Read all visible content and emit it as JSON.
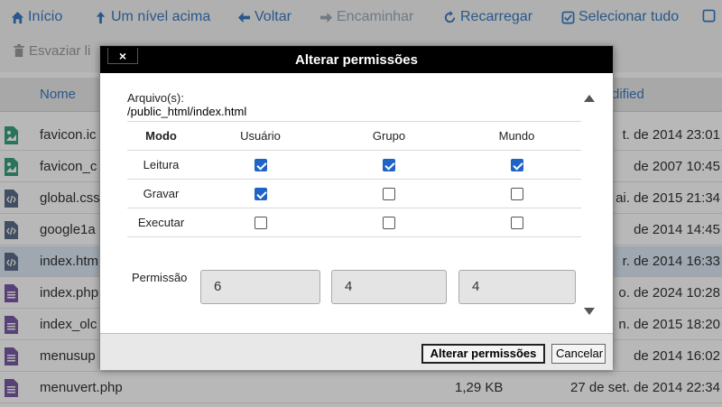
{
  "toolbar": {
    "home": "Início",
    "up": "Um nível acima",
    "back": "Voltar",
    "forward": "Encaminhar",
    "reload": "Recarregar",
    "select_all": "Selecionar tudo",
    "empty_trash": "Esvaziar li"
  },
  "list": {
    "col_name": "Nome",
    "col_modified": "dified",
    "rows": [
      {
        "name": "favicon.ic",
        "size": "",
        "date": "t. de 2014 23:01",
        "type": "image"
      },
      {
        "name": "favicon_c",
        "size": "",
        "date": "de 2007 10:45",
        "type": "image"
      },
      {
        "name": "global.css",
        "size": "",
        "date": "ai. de 2015 21:34",
        "type": "code"
      },
      {
        "name": "google1a",
        "size": "",
        "date": "de 2014 14:45",
        "type": "code"
      },
      {
        "name": "index.htm",
        "size": "",
        "date": "r. de 2014 16:33",
        "type": "code"
      },
      {
        "name": "index.php",
        "size": "",
        "date": "o. de 2024 10:28",
        "type": "php"
      },
      {
        "name": "index_olc",
        "size": "",
        "date": "n. de 2015 18:20",
        "type": "php"
      },
      {
        "name": "menusup",
        "size": "",
        "date": "de 2014 16:02",
        "type": "php"
      },
      {
        "name": "menuvert.php",
        "size": "1,29 KB",
        "date": "27 de set. de 2014 22:34",
        "type": "php"
      }
    ]
  },
  "dialog": {
    "close": "×",
    "title": "Alterar permissões",
    "file_label": "Arquivo(s):",
    "file_path": "/public_html/index.html",
    "headers": {
      "mode": "Modo",
      "user": "Usuário",
      "group": "Grupo",
      "world": "Mundo"
    },
    "rows": [
      {
        "label": "Leitura",
        "user": true,
        "group": true,
        "world": true
      },
      {
        "label": "Gravar",
        "user": true,
        "group": false,
        "world": false
      },
      {
        "label": "Executar",
        "user": false,
        "group": false,
        "world": false
      }
    ],
    "permission_label": "Permissão",
    "permission_values": {
      "user": "6",
      "group": "4",
      "world": "4"
    },
    "apply_button": "Alterar permissões",
    "cancel_button": "Cancelar"
  },
  "colors": {
    "link": "#3a7bbf",
    "checkbox_checked": "#1f63c6",
    "titlebar": "#000000",
    "icon_image": "#3aa17e",
    "icon_code": "#5c6e8a",
    "icon_php": "#7a5aa6"
  }
}
